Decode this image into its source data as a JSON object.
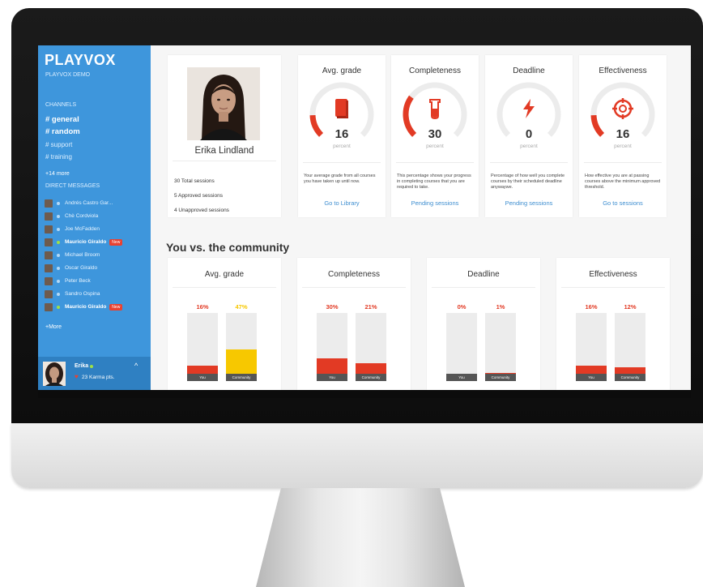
{
  "sidebar": {
    "logo": "PLAYVOX",
    "subtitle": "PLAYVOX DEMO",
    "channels_heading": "CHANNELS",
    "channels": [
      {
        "label": "# general",
        "bold": true
      },
      {
        "label": "# random",
        "bold": true
      },
      {
        "label": "# support",
        "bold": false
      },
      {
        "label": "# training",
        "bold": false
      }
    ],
    "channels_more": "+14 more",
    "dm_heading": "DIRECT MESSAGES",
    "direct_messages": [
      {
        "name": "Andrés Castro Gar...",
        "online": false,
        "bold": false,
        "new": false
      },
      {
        "name": "Chè Cordviola",
        "online": false,
        "bold": false,
        "new": false
      },
      {
        "name": "Joe McFadden",
        "online": false,
        "bold": false,
        "new": false
      },
      {
        "name": "Mauricio Giraldo",
        "online": true,
        "bold": true,
        "new": true
      },
      {
        "name": "Michael Broom",
        "online": false,
        "bold": false,
        "new": false
      },
      {
        "name": "Oscar Giraldo",
        "online": false,
        "bold": false,
        "new": false
      },
      {
        "name": "Peter Beck",
        "online": false,
        "bold": false,
        "new": false
      },
      {
        "name": "Sandro Ospina",
        "online": false,
        "bold": false,
        "new": false
      },
      {
        "name": "Mauricio Giraldo",
        "online": true,
        "bold": true,
        "new": true
      }
    ],
    "new_badge": "New",
    "dm_more": "+More",
    "user": {
      "name": "Erika",
      "karma": "23 Karma pts.",
      "chevron": "^"
    }
  },
  "profile": {
    "name": "Erika Lindland",
    "stats": [
      "30 Total sessions",
      "5 Approved sessions",
      "4 Unapproved sessions"
    ]
  },
  "metrics": [
    {
      "title": "Avg. grade",
      "value": "16",
      "unit": "percent",
      "fraction": 0.16,
      "icon": "book-icon",
      "desc": "Your average grade from all courses you have taken up until now.",
      "link": "Go to Library"
    },
    {
      "title": "Completeness",
      "value": "30",
      "unit": "percent",
      "fraction": 0.3,
      "icon": "beaker-icon",
      "desc": "This percentage shows your progress in completing courses that you are required to take.",
      "link": "Pending sessions"
    },
    {
      "title": "Deadline",
      "value": "0",
      "unit": "percent",
      "fraction": 0.0,
      "icon": "lightning-icon",
      "desc": "Percentage of how well you complete courses by their scheduled deadline anywaywe.",
      "link": "Pending sessions"
    },
    {
      "title": "Effectiveness",
      "value": "16",
      "unit": "percent",
      "fraction": 0.16,
      "icon": "target-icon",
      "desc": "How effective you are at passing courses above the minimum approved threshold.",
      "link": "Go to sessions"
    }
  ],
  "community": {
    "title": "You vs. the community",
    "you_label": "You",
    "community_label": "Community",
    "cards": [
      {
        "title": "Avg. grade",
        "you": "16%",
        "you_value": 0.16,
        "community": "47%",
        "community_value": 0.47,
        "community_color": "#f7c800",
        "community_pct_color": "#f7c800"
      },
      {
        "title": "Completeness",
        "you": "30%",
        "you_value": 0.3,
        "community": "21%",
        "community_value": 0.21,
        "community_color": "#e23a24",
        "community_pct_color": "#e23a24"
      },
      {
        "title": "Deadline",
        "you": "0%",
        "you_value": 0.0,
        "community": "1%",
        "community_value": 0.01,
        "community_color": "#e23a24",
        "community_pct_color": "#e23a24"
      },
      {
        "title": "Effectiveness",
        "you": "16%",
        "you_value": 0.16,
        "community": "12%",
        "community_value": 0.12,
        "community_color": "#e23a24",
        "community_pct_color": "#e23a24"
      }
    ]
  },
  "colors": {
    "accent_red": "#e23a24",
    "sidebar_blue": "#3e96dc",
    "link_blue": "#3e8ed0"
  }
}
